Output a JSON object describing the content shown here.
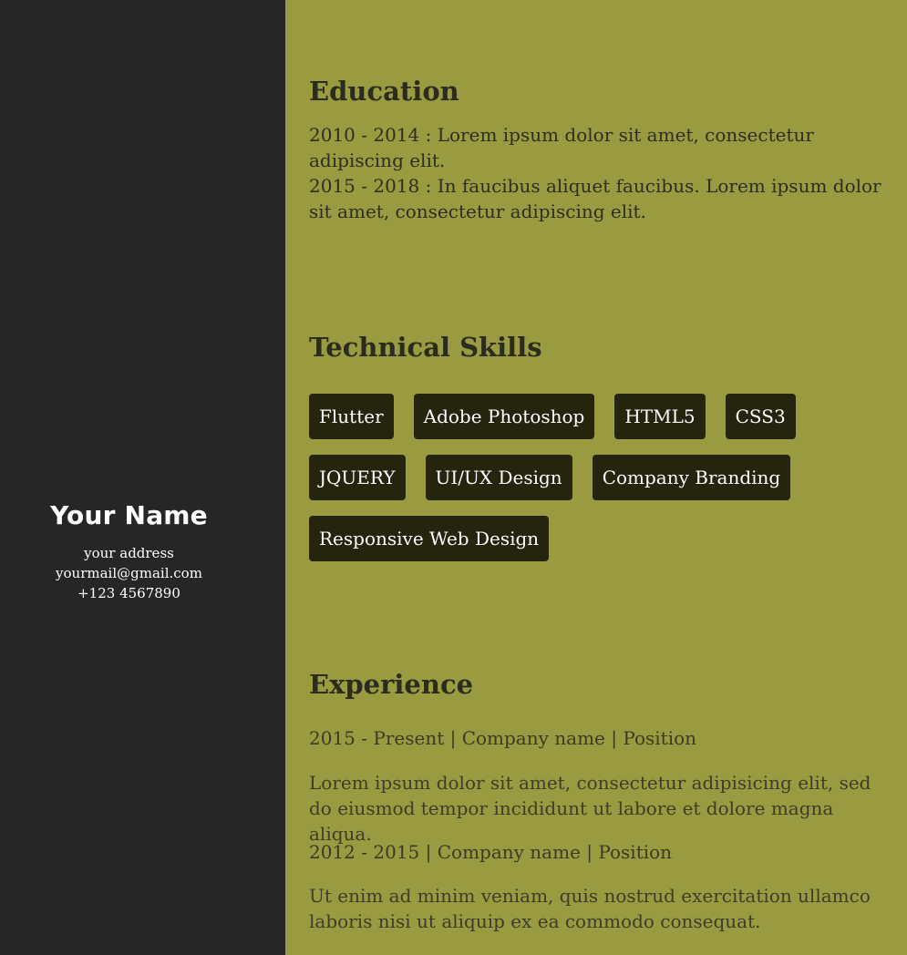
{
  "profile": {
    "name": "Your Name",
    "address": "your address",
    "email": "yourmail@gmail.com",
    "phone": "+123 4567890"
  },
  "education": {
    "title": "Education",
    "entries": [
      "2010 - 2014 : Lorem ipsum dolor sit amet, consectetur adipiscing elit.",
      "2015 - 2018 : In faucibus aliquet faucibus. Lorem ipsum dolor sit amet, consectetur adipiscing elit."
    ]
  },
  "skills": {
    "title": "Technical Skills",
    "items": [
      "Flutter",
      "Adobe Photoshop",
      "HTML5",
      "CSS3",
      "JQUERY",
      "UI/UX Design",
      "Company Branding",
      "Responsive Web Design"
    ]
  },
  "experience": {
    "title": "Experience",
    "entries": [
      {
        "heading": "2015 - Present | Company name | Position",
        "description": "Lorem ipsum dolor sit amet, consectetur adipisicing elit, sed do eiusmod tempor incididunt ut labore et dolore magna aliqua."
      },
      {
        "heading": "2012 - 2015 | Company name | Position",
        "description": "Ut enim ad minim veniam, quis nostrud exercitation ullamco laboris nisi ut aliquip ex ea commodo consequat."
      }
    ]
  },
  "colors": {
    "sidebar_bg": "#262626",
    "main_bg": "#9a9a40",
    "tag_bg": "#25250f",
    "heading_text": "#2b2b1e"
  }
}
